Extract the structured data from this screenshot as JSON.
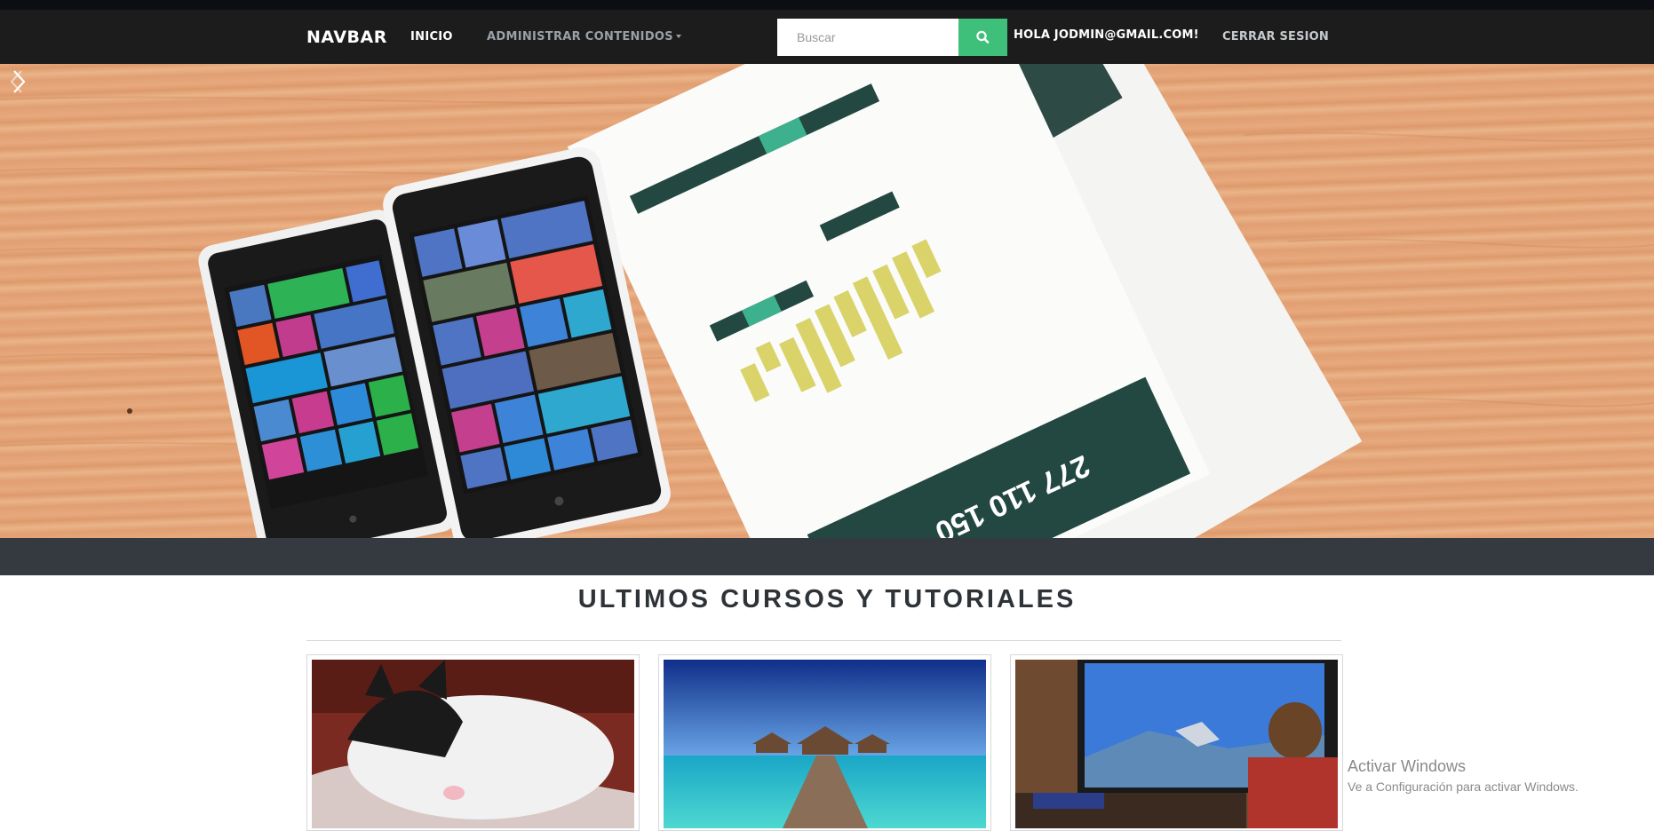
{
  "navbar": {
    "brand": "NAVBAR",
    "inicio": "INICIO",
    "admin": "ADMINISTRAR CONTENIDOS",
    "search_placeholder": "Buscar",
    "greeting": "HOLA JODMIN@GMAIL.COM!",
    "logout": "CERRAR SESION"
  },
  "section": {
    "title": "ULTIMOS CURSOS Y TUTORIALES"
  },
  "watermark": {
    "title": "Activar Windows",
    "subtitle": "Ve a Configuración para activar Windows."
  },
  "icons": {
    "search": "search-icon",
    "prev": "chevron-left-icon",
    "next": "chevron-right-icon",
    "caret": "caret-down-icon"
  },
  "colors": {
    "navbar_bg": "#1c1c1c",
    "search_button": "#3fc07a",
    "dark_band": "#343a40"
  }
}
